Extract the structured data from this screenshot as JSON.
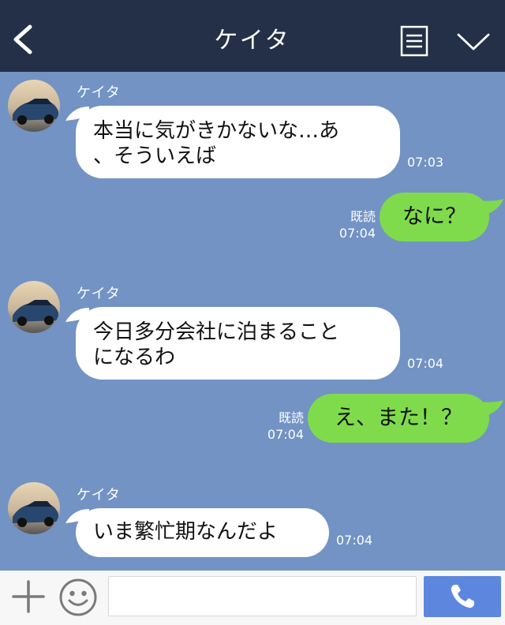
{
  "header": {
    "title": "ケイタ",
    "back_icon": "chevron-left-icon",
    "menu_icon": "note-icon",
    "toggle_icon": "chevron-down-icon"
  },
  "messages": [
    {
      "side": "in",
      "sender": "ケイタ",
      "lines": [
        "本当に気がきかないな…あ",
        "、そういえば"
      ],
      "time": "07:03"
    },
    {
      "side": "out",
      "text": "なに？",
      "read": "既読",
      "time": "07:04"
    },
    {
      "side": "in",
      "sender": "ケイタ",
      "lines": [
        "今日多分会社に泊まること",
        "になるわ"
      ],
      "time": "07:04"
    },
    {
      "side": "out",
      "text": "え、また！？",
      "read": "既読",
      "time": "07:04"
    },
    {
      "side": "in",
      "sender": "ケイタ",
      "lines": [
        "いま繁忙期なんだよ"
      ],
      "time": "07:04"
    }
  ],
  "input_bar": {
    "plus_icon": "plus-icon",
    "emoji_icon": "smiley-icon",
    "call_icon": "phone-icon"
  },
  "colors": {
    "header": "#233047",
    "chat_bg": "#7293c4",
    "outgoing": "#7fdb4b",
    "incoming": "#ffffff",
    "call_button": "#5d86de"
  }
}
